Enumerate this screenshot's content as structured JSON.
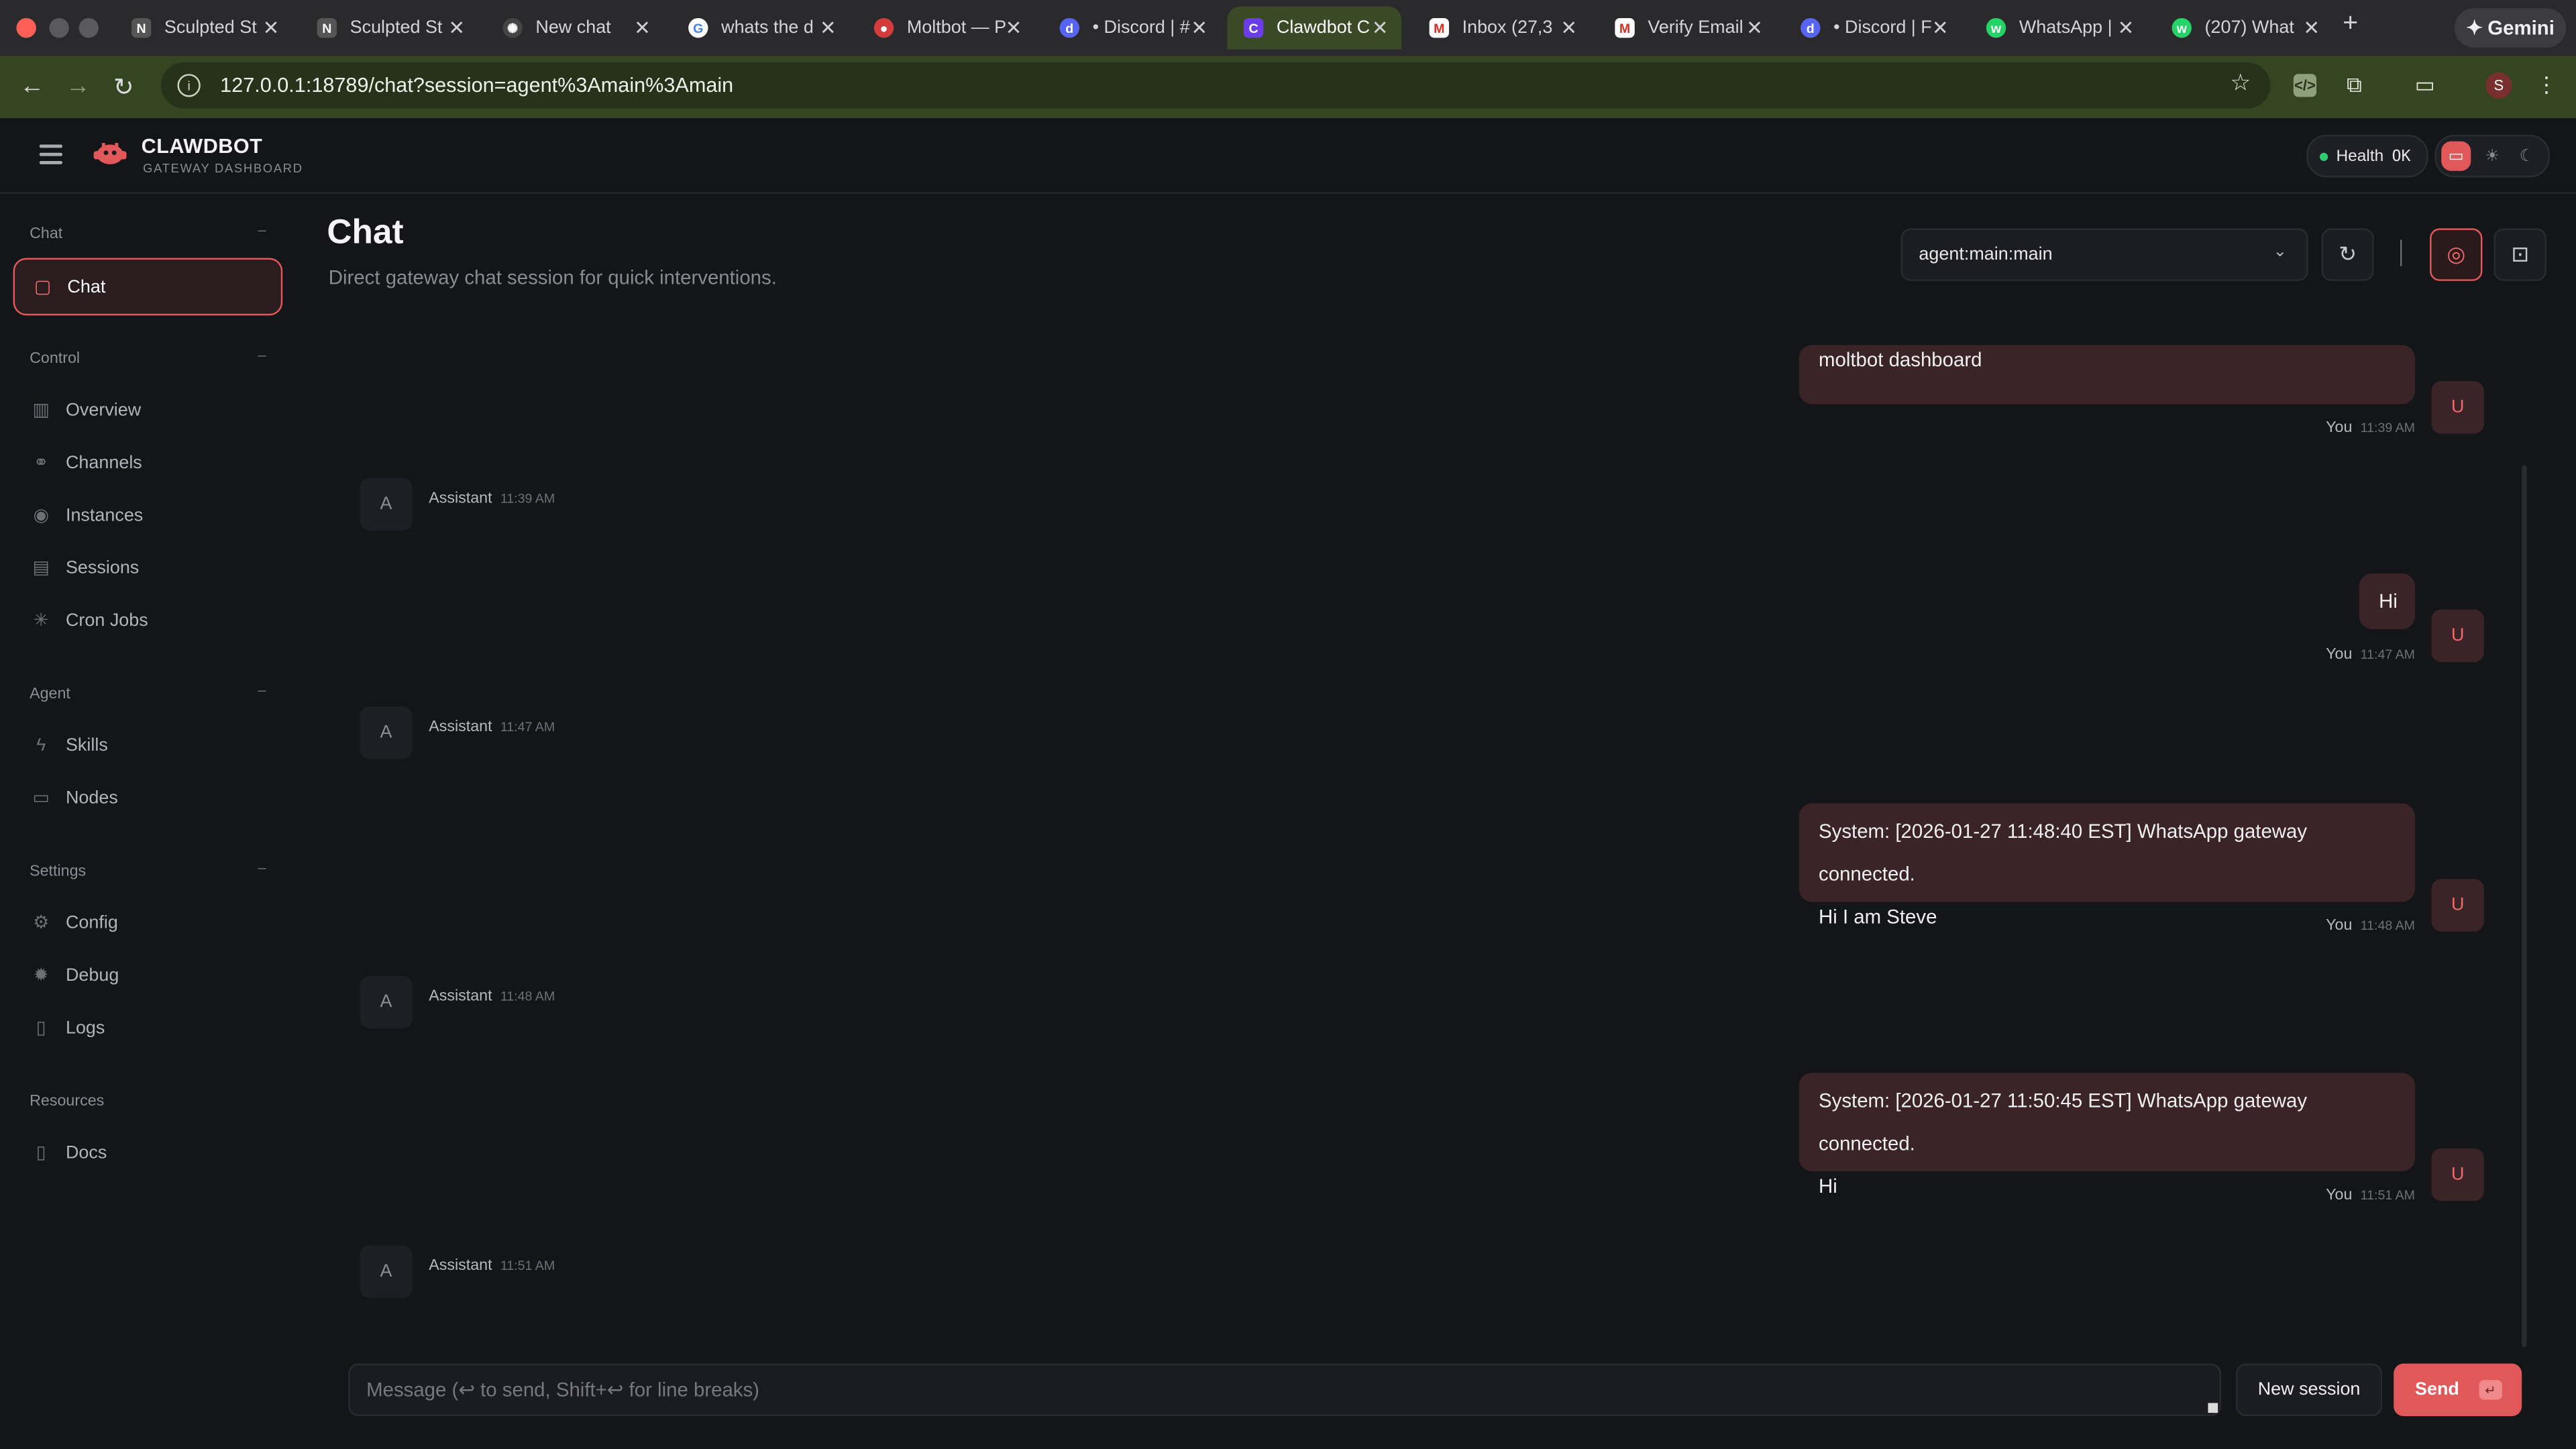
{
  "browser": {
    "tabs": [
      {
        "title": "Sculpted St",
        "favicon": "notion-icon",
        "color": "#555"
      },
      {
        "title": "Sculpted St",
        "favicon": "notion-icon",
        "color": "#555"
      },
      {
        "title": "New chat",
        "favicon": "openai-icon",
        "color": "#444"
      },
      {
        "title": "whats the d",
        "favicon": "google-icon",
        "color": "#ffffff"
      },
      {
        "title": "Moltbot — P",
        "favicon": "moltbot-icon",
        "color": "#d43b3b"
      },
      {
        "title": "• Discord | #",
        "favicon": "discord-icon",
        "color": "#5865f2"
      },
      {
        "title": "Clawdbot C",
        "favicon": "clawdbot-icon",
        "color": "#6a3de8"
      },
      {
        "title": "Inbox (27,3",
        "favicon": "gmail-icon",
        "color": "#ffffff"
      },
      {
        "title": "Verify Email",
        "favicon": "gmail-icon",
        "color": "#ffffff"
      },
      {
        "title": "• Discord | F",
        "favicon": "discord-icon",
        "color": "#5865f2"
      },
      {
        "title": "WhatsApp |",
        "favicon": "whatsapp-icon",
        "color": "#25d366"
      },
      {
        "title": "(207) What",
        "favicon": "whatsapp-icon",
        "color": "#25d366"
      }
    ],
    "active_tab_index": 6,
    "gemini_label": "Gemini",
    "url": "127.0.0.1:18789/chat?session=agent%3Amain%3Amain",
    "profile_initial": "S"
  },
  "app": {
    "brand": "CLAWDBOT",
    "brand_sub": "GATEWAY DASHBOARD",
    "health_label": "Health",
    "health_value": "OK"
  },
  "sidebar": {
    "sections": [
      {
        "label": "Chat",
        "items": [
          {
            "label": "Chat",
            "icon": "chat-bubble-icon",
            "active": true
          }
        ]
      },
      {
        "label": "Control",
        "items": [
          {
            "label": "Overview",
            "icon": "bar-chart-icon"
          },
          {
            "label": "Channels",
            "icon": "link-icon"
          },
          {
            "label": "Instances",
            "icon": "radio-icon"
          },
          {
            "label": "Sessions",
            "icon": "document-icon"
          },
          {
            "label": "Cron Jobs",
            "icon": "loader-icon"
          }
        ]
      },
      {
        "label": "Agent",
        "items": [
          {
            "label": "Skills",
            "icon": "zap-icon"
          },
          {
            "label": "Nodes",
            "icon": "monitor-icon"
          }
        ]
      },
      {
        "label": "Settings",
        "items": [
          {
            "label": "Config",
            "icon": "gear-icon"
          },
          {
            "label": "Debug",
            "icon": "bug-icon"
          },
          {
            "label": "Logs",
            "icon": "scroll-icon"
          }
        ]
      },
      {
        "label": "Resources",
        "items": [
          {
            "label": "Docs",
            "icon": "book-icon"
          }
        ]
      }
    ]
  },
  "main": {
    "title": "Chat",
    "subtitle": "Direct gateway chat session for quick interventions.",
    "session": "agent:main:main"
  },
  "messages": {
    "top_partial_text": "moltbot dashboard",
    "m1_time": "11:39 AM",
    "a1_time": "11:39 AM",
    "m2_text": "Hi",
    "m2_time": "11:47 AM",
    "a2_time": "11:47 AM",
    "m3_line1": "System: [2026-01-27 11:48:40 EST] WhatsApp gateway connected.",
    "m3_line2": "Hi I am Steve",
    "m3_time": "11:48 AM",
    "a3_time": "11:48 AM",
    "m4_line1": "System: [2026-01-27 11:50:45 EST] WhatsApp gateway connected.",
    "m4_line2": "Hi",
    "m4_time": "11:51 AM",
    "a4_time": "11:51 AM",
    "you_label": "You",
    "assistant_label": "Assistant",
    "user_avatar": "U",
    "assistant_avatar": "A"
  },
  "composer": {
    "placeholder": "Message (↩ to send, Shift+↩ for line breaks)",
    "new_session_label": "New session",
    "send_label": "Send",
    "send_kbd": "↵"
  },
  "colors": {
    "accent": "#e1585a",
    "user_bubble": "#3a2428",
    "health_dot": "#2ecc71"
  }
}
